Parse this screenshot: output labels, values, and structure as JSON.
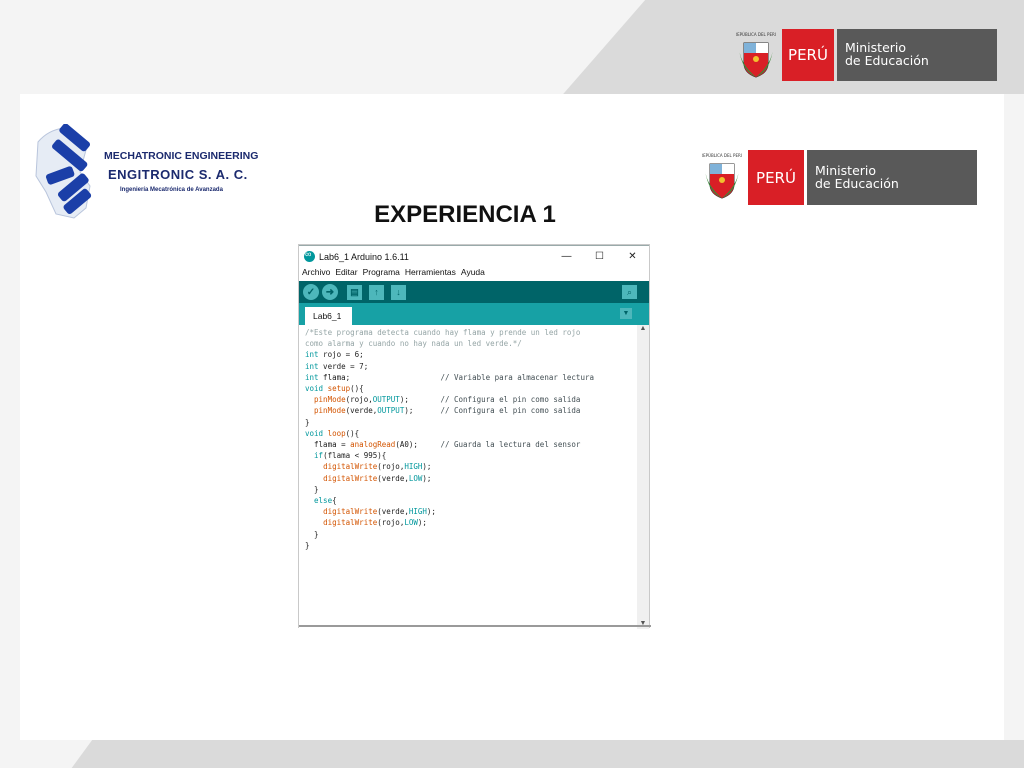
{
  "header_logo": {
    "shield_text": "REPÚBLICA DEL PERÚ",
    "country": "PERÚ",
    "ministry_line1": "Ministerio",
    "ministry_line2": "de Educación"
  },
  "company_logo": {
    "line1": "MECHATRONIC ENGINEERING",
    "line2": "ENGITRONIC  S. A. C.",
    "line3": "Ingeniería  Mecatrónica  de  Avanzada"
  },
  "inner_logo": {
    "shield_text": "REPÚBLICA DEL PERÚ",
    "country": "PERÚ",
    "ministry_line1": "Ministerio",
    "ministry_line2": "de Educación"
  },
  "slide_title": "EXPERIENCIA 1",
  "window": {
    "title": "Lab6_1 Arduino 1.6.11",
    "controls": {
      "minimize": "—",
      "maximize": "☐",
      "close": "✕"
    },
    "menu": [
      "Archivo",
      "Editar",
      "Programa",
      "Herramientas",
      "Ayuda"
    ],
    "toolbar": {
      "verify": "✓",
      "upload": "➜",
      "new": "▤",
      "open": "↑",
      "save": "↓",
      "serial_monitor": "⌕"
    },
    "tab_label": "Lab6_1",
    "tab_menu": "▼",
    "scroll_up": "▲",
    "scroll_down": "▼",
    "code_lines": [
      "/*Este programa detecta cuando hay flama y prende un led rojo",
      "como alarma y cuando no hay nada un led verde.*/",
      "int rojo = 6;",
      "int verde = 7;",
      "int flama;                    // Variable para almacenar lectura",
      "void setup(){",
      "  pinMode(rojo,OUTPUT);       // Configura el pin como salida",
      "  pinMode(verde,OUTPUT);      // Configura el pin como salida",
      "}",
      "void loop(){",
      "  flama = analogRead(A0);     // Guarda la lectura del sensor",
      "  if(flama < 995){",
      "    digitalWrite(rojo,HIGH);",
      "    digitalWrite(verde,LOW);",
      "  }",
      "  else{",
      "    digitalWrite(verde,HIGH);",
      "    digitalWrite(rojo,LOW);",
      "  }",
      "}"
    ]
  },
  "colors": {
    "peru_red": "#d91f26",
    "ministry_gray": "#595959",
    "arduino_dark_teal": "#006468",
    "arduino_teal": "#17a1a5",
    "engitronic_blue": "#1b3fa8"
  }
}
